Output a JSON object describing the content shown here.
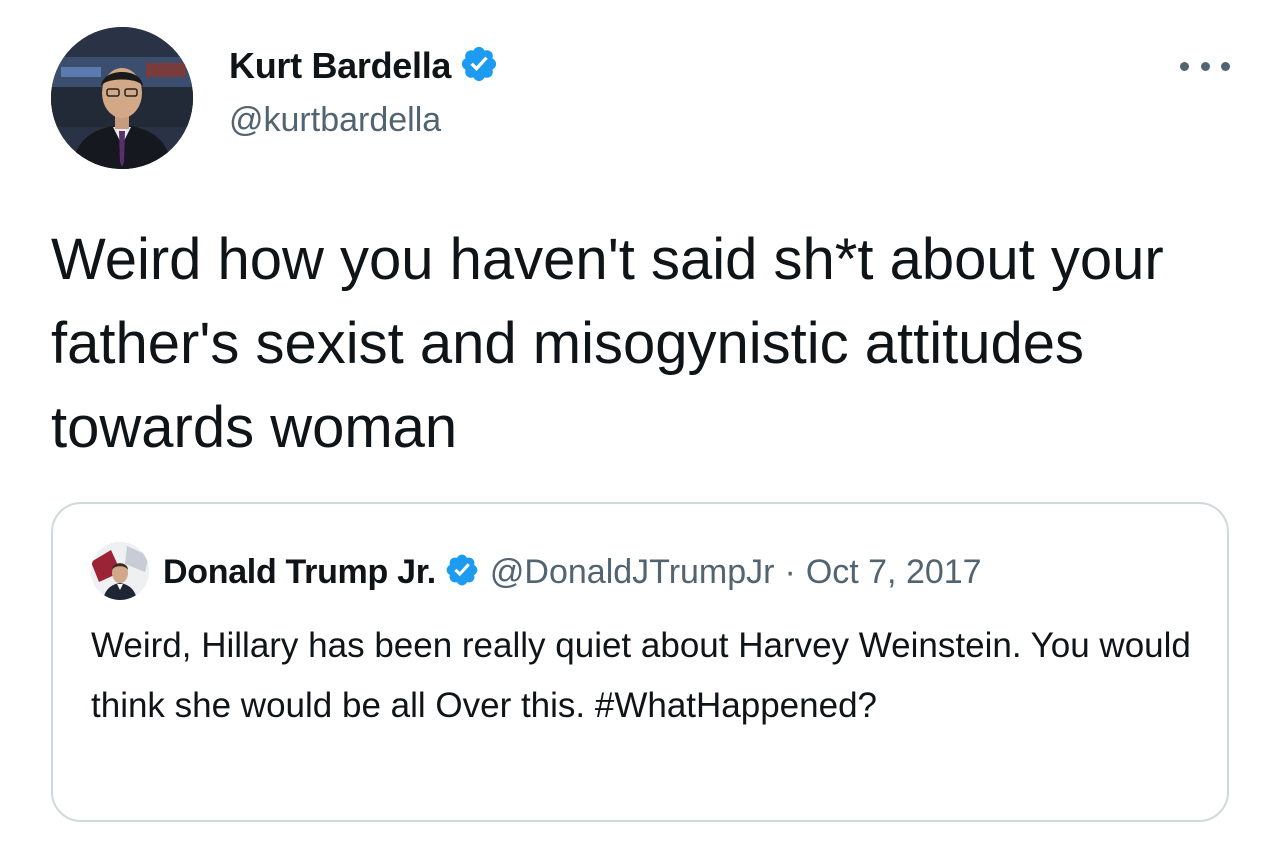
{
  "tweet": {
    "author": {
      "name": "Kurt Bardella",
      "handle": "@kurtbardella",
      "verified": true
    },
    "text": "Weird how you haven't said sh*t about your father's sexist and misogynistic attitudes towards woman",
    "more_icon": "more-horizontal-icon"
  },
  "quote": {
    "author": {
      "name": "Donald Trump Jr.",
      "handle": "@DonaldJTrumpJr",
      "verified": true
    },
    "separator": "·",
    "date": "Oct 7, 2017",
    "text": "Weird, Hillary has been really quiet about Harvey Weinstein. You would think she would be all Over this. #WhatHappened?"
  },
  "colors": {
    "verified_blue": "#1d9bf0",
    "secondary_text": "#536471",
    "border": "#cfd9de"
  }
}
